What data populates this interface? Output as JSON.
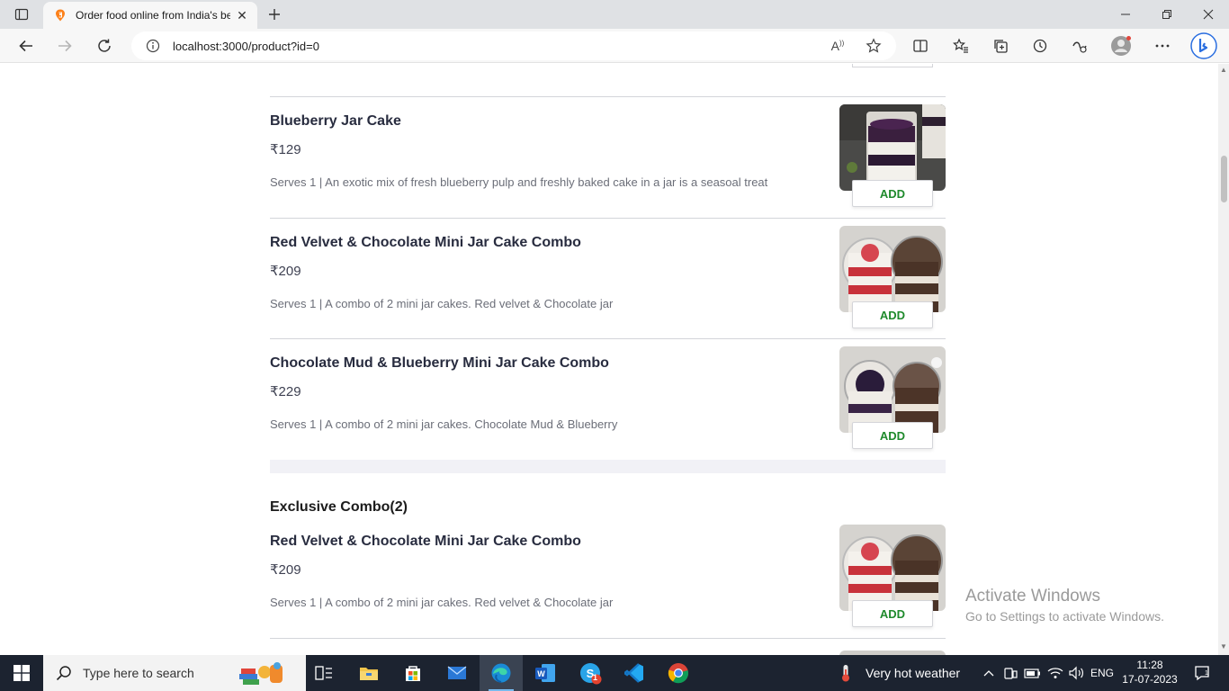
{
  "browser": {
    "tab_title": "Order food online from India's be",
    "url": "localhost:3000/product?id=0",
    "read_aloud_label": "A",
    "notification_count": "1"
  },
  "menu": {
    "items_group_1": [
      {
        "name": "Blueberry Jar Cake",
        "price": "₹129",
        "description": "Serves 1 | An exotic mix of fresh blueberry pulp and freshly baked cake in a jar is a seasoal treat",
        "add_label": "ADD"
      },
      {
        "name": "Red Velvet & Chocolate Mini Jar Cake Combo",
        "price": "₹209",
        "description": "Serves 1 | A combo of 2 mini jar cakes. Red velvet & Chocolate jar",
        "add_label": "ADD"
      },
      {
        "name": "Chocolate Mud & Blueberry Mini Jar Cake Combo",
        "price": "₹229",
        "description": "Serves 1 | A combo of 2 mini jar cakes. Chocolate Mud & Blueberry",
        "add_label": "ADD"
      }
    ],
    "section_title": "Exclusive Combo(2)",
    "items_group_2": [
      {
        "name": "Red Velvet & Chocolate Mini Jar Cake Combo",
        "price": "₹209",
        "description": "Serves 1 | A combo of 2 mini jar cakes. Red velvet & Chocolate jar",
        "add_label": "ADD"
      }
    ]
  },
  "watermark": {
    "line1": "Activate Windows",
    "line2": "Go to Settings to activate Windows."
  },
  "taskbar": {
    "search_placeholder": "Type here to search",
    "weather": "Very hot weather",
    "language": "ENG",
    "time": "11:28",
    "date": "17-07-2023",
    "swiggy_badge": "1"
  },
  "colors": {
    "add_text": "#1f8a2c",
    "swiggy_orange": "#fc8019",
    "taskbar_bg": "#1c2330"
  }
}
